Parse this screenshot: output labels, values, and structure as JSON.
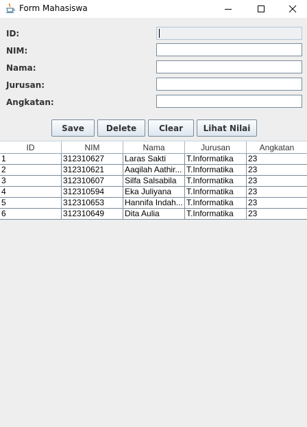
{
  "window": {
    "title": "Form Mahasiswa"
  },
  "form": {
    "id_label": "ID:",
    "nim_label": "NIM:",
    "nama_label": "Nama:",
    "jurusan_label": "Jurusan:",
    "angkatan_label": "Angkatan:",
    "id_value": "",
    "nim_value": "",
    "nama_value": "",
    "jurusan_value": "",
    "angkatan_value": ""
  },
  "buttons": {
    "save": "Save",
    "delete": "Delete",
    "clear": "Clear",
    "lihat_nilai": "Lihat Nilai"
  },
  "table": {
    "columns": [
      "ID",
      "NIM",
      "Nama",
      "Jurusan",
      "Angkatan"
    ],
    "rows": [
      [
        "1",
        "312310627",
        "Laras Sakti",
        "T.Informatika",
        "23"
      ],
      [
        "2",
        "312310621",
        "Aaqilah Aathir...",
        "T.Informatika",
        "23"
      ],
      [
        "3",
        "312310607",
        "Silfa Salsabila",
        "T.Informatika",
        "23"
      ],
      [
        "4",
        "312310594",
        "Eka Juliyana",
        "T.Informatika",
        "23"
      ],
      [
        "5",
        "312310653",
        "Hannifa Indah...",
        "T.Informatika",
        "23"
      ],
      [
        "6",
        "312310649",
        "Dita Aulia",
        "T.Informatika",
        "23"
      ]
    ]
  },
  "icons": {
    "app": "java-cup-icon",
    "minimize": "minimize-icon",
    "maximize": "maximize-icon",
    "close": "close-icon"
  }
}
